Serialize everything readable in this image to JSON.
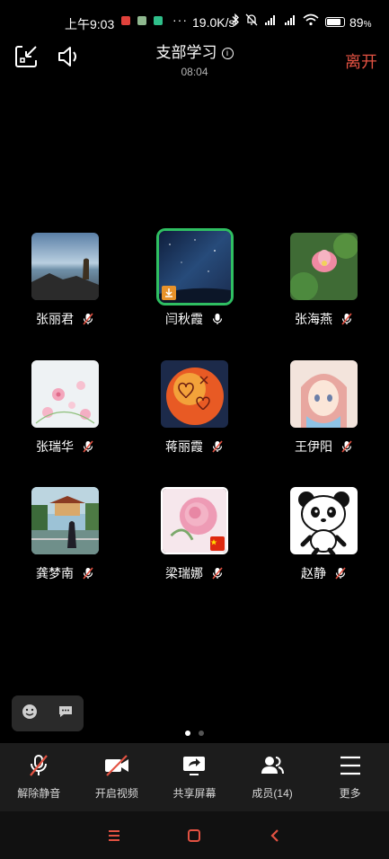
{
  "status_bar": {
    "time": "上午9:03",
    "dots": "···",
    "network_speed": "19.0K/s",
    "battery_percent": "89",
    "battery_unit": "%",
    "battery_level": 0.89,
    "app_icon_colors": [
      "#e0413b",
      "#8fb88f",
      "#2fbf8a"
    ]
  },
  "header": {
    "title": "支部学习",
    "info_glyph": "i",
    "timer": "08:04",
    "leave_label": "离开",
    "leave_color": "#e35242"
  },
  "participants": [
    {
      "name": "张丽君",
      "muted": true,
      "avatar": "seaside-photo"
    },
    {
      "name": "闫秋霞",
      "muted": false,
      "speaking": true,
      "avatar": "night-sky-photo",
      "badge": "download-badge"
    },
    {
      "name": "张海燕",
      "muted": true,
      "avatar": "lotus-photo"
    },
    {
      "name": "张瑞华",
      "muted": true,
      "avatar": "pink-flowers-photo"
    },
    {
      "name": "蒋丽霞",
      "muted": true,
      "avatar": "heart-ball-photo"
    },
    {
      "name": "王伊阳",
      "muted": true,
      "avatar": "anime-girl-photo"
    },
    {
      "name": "龚梦南",
      "muted": true,
      "avatar": "garden-pavilion-photo"
    },
    {
      "name": "梁瑞娜",
      "muted": true,
      "avatar": "pink-rose-photo",
      "badge": "china-flag-badge"
    },
    {
      "name": "赵静",
      "muted": true,
      "avatar": "panda-cartoon"
    }
  ],
  "reactions": {
    "emoji_icon": "smiley-icon",
    "chat_icon": "chat-bubble-icon"
  },
  "pager": {
    "pages": 2,
    "current": 1
  },
  "toolbar": {
    "unmute_label": "解除静音",
    "video_label": "开启视频",
    "share_label": "共享屏幕",
    "members_label": "成员(14)",
    "more_label": "更多"
  },
  "colors": {
    "speaking_border": "#2fbf62",
    "toolbar_bg": "#1c1c1c",
    "nav_icon": "#e35242"
  }
}
